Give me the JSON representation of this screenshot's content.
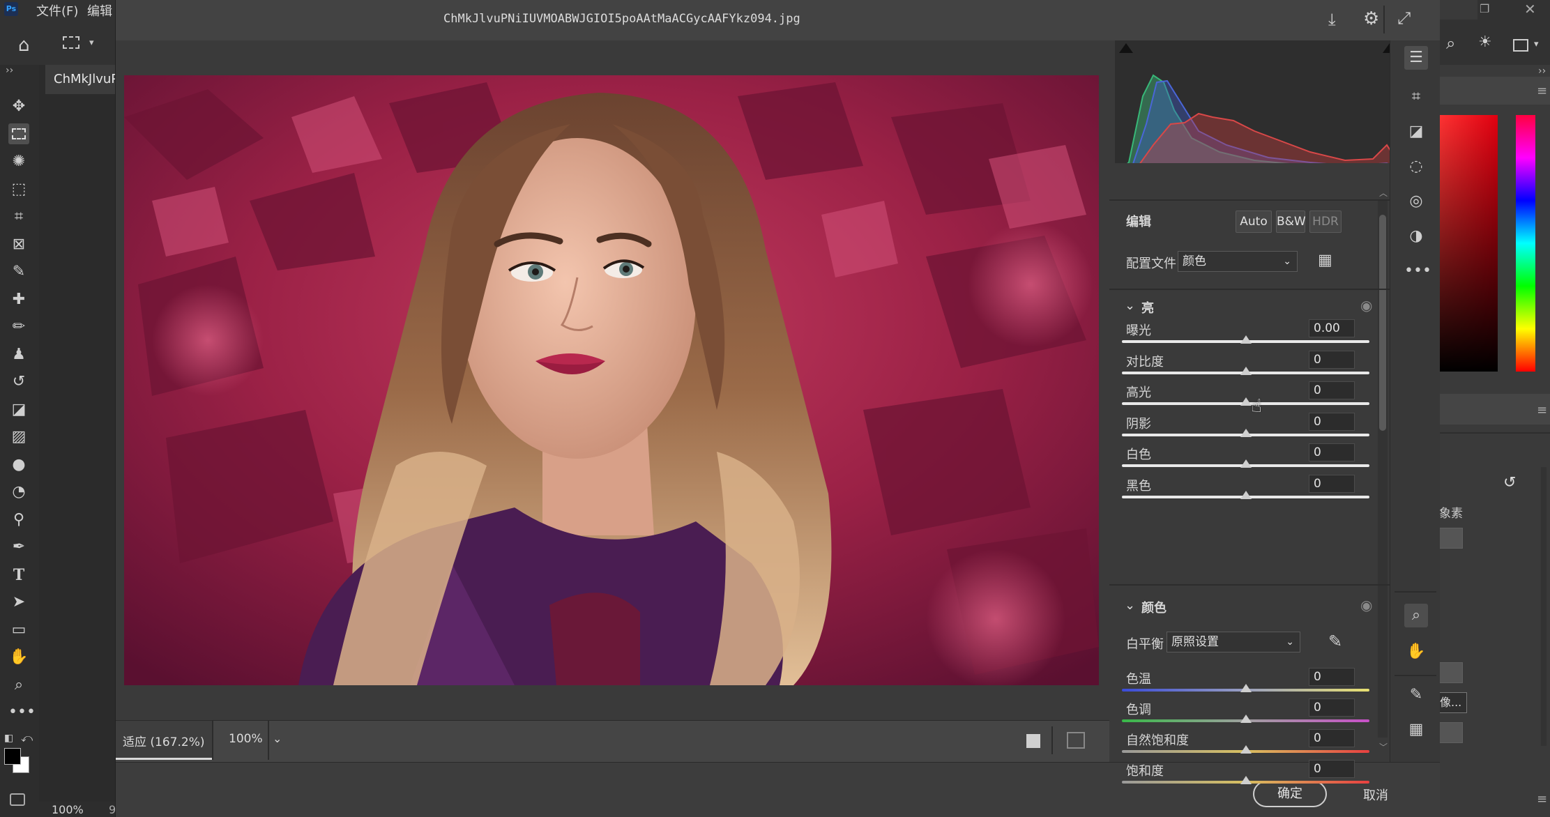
{
  "photoshop": {
    "menu": [
      "文件(F)",
      "编辑"
    ],
    "doc_tab": "ChMkJlvuP",
    "zoom": "100%",
    "status_extra": "9",
    "right_panel_text": [
      "象素",
      "像..."
    ]
  },
  "dialog": {
    "title": "ChMkJlvuPNiIUVMOABWJGIOI5poAAtMaACGycAAFYkz094.jpg",
    "footer": {
      "fit_label": "适应 (167.2%)",
      "zoom_label": "100%"
    },
    "ok_label": "确定",
    "cancel_label": "取消"
  },
  "panel": {
    "edit_title": "编辑",
    "mode_buttons": [
      "Auto",
      "B&W",
      "HDR"
    ],
    "profile_label": "配置文件",
    "profile_value": "颜色",
    "light": {
      "title": "亮",
      "sliders": [
        {
          "label": "曝光",
          "value": "0.00",
          "pos": 0.5
        },
        {
          "label": "对比度",
          "value": "0",
          "pos": 0.5
        },
        {
          "label": "高光",
          "value": "0",
          "pos": 0.5
        },
        {
          "label": "阴影",
          "value": "0",
          "pos": 0.5
        },
        {
          "label": "白色",
          "value": "0",
          "pos": 0.5
        },
        {
          "label": "黑色",
          "value": "0",
          "pos": 0.5
        }
      ]
    },
    "color": {
      "title": "颜色",
      "wb_label": "白平衡",
      "wb_value": "原照设置",
      "sliders": [
        {
          "label": "色温",
          "value": "0",
          "pos": 0.5
        },
        {
          "label": "色调",
          "value": "0",
          "pos": 0.5
        },
        {
          "label": "自然饱和度",
          "value": "0",
          "pos": 0.5
        },
        {
          "label": "饱和度",
          "value": "0",
          "pos": 0.5
        }
      ]
    }
  },
  "colors": {
    "accent": "#2e8bd9",
    "dialog_bg": "#3d3d3d",
    "panel_bg": "#3a3a3a"
  }
}
